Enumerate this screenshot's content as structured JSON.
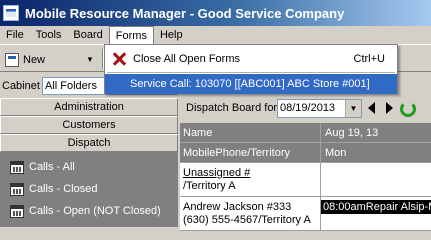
{
  "window": {
    "title": "Mobile Resource Manager - Good Service Company"
  },
  "menubar": {
    "items": [
      "File",
      "Tools",
      "Board",
      "Forms",
      "Help"
    ]
  },
  "toolbar": {
    "new_label": "New"
  },
  "cabinet": {
    "label": "Cabinet",
    "value": "All Folders"
  },
  "sidebar": {
    "buttons": [
      "Administration",
      "Customers",
      "Dispatch"
    ],
    "calls": [
      "Calls - All",
      "Calls - Closed",
      "Calls - Open (NOT Closed)"
    ]
  },
  "dispatch_board": {
    "label": "Dispatch Board for",
    "date": "08/19/2013",
    "header_row1": {
      "left": "Name",
      "right": "Aug 19, 13"
    },
    "header_row2": {
      "left": "MobilePhone/Territory",
      "right": "Mon"
    },
    "rows": [
      {
        "name": "Unassigned #",
        "sub": "/Territory A",
        "appointment": ""
      },
      {
        "name": "Andrew Jackson #333",
        "sub": "(630) 555-4567/Territory A",
        "appointment": "08:00amRepair Alsip-M"
      }
    ]
  },
  "forms_menu": {
    "close_all_label": "Close All Open Forms",
    "close_all_shortcut": "Ctrl+U",
    "service_call_label": "Service Call: 103070 [[ABC001] ABC Store #001]"
  },
  "colors": {
    "title_gradient_start": "#0a246a",
    "menu_highlight": "#316ac5",
    "panel_dark": "#808080",
    "chrome": "#d4d0c8"
  }
}
